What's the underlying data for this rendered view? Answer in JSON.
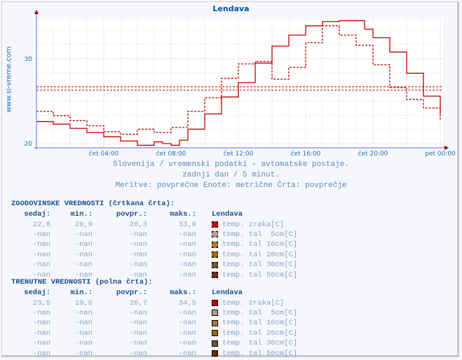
{
  "title": "Lendava",
  "side_label": "www.si-vreme.com",
  "subtitle_lines": [
    "Slovenija / vremenski podatki - avtomatske postaje.",
    "zadnji dan / 5 minut.",
    "Meritve: povprečne  Enote: metrične  Črta: povprečje"
  ],
  "colors": {
    "series": "#c00000",
    "axis": "#6060ff",
    "axis_arrow": "#8b0000",
    "grid": "#e8b0b0"
  },
  "chart_data": {
    "type": "line",
    "title": "Lendava",
    "xlabel": "",
    "ylabel": "",
    "x_unit": "hours since čet 00:00",
    "xlim": [
      0,
      24
    ],
    "ylim": [
      19.6,
      35.5
    ],
    "x_ticks": [
      {
        "x": 4,
        "label": "čet 04:00"
      },
      {
        "x": 8,
        "label": "čet 08:00"
      },
      {
        "x": 12,
        "label": "čet 12:00"
      },
      {
        "x": 16,
        "label": "čet 16:00"
      },
      {
        "x": 20,
        "label": "čet 20:00"
      },
      {
        "x": 24,
        "label": "pet 00:00"
      }
    ],
    "y_ticks": [
      {
        "y": 20,
        "label": "20"
      },
      {
        "y": 30,
        "label": "30"
      }
    ],
    "grid": true,
    "reference_lines": [
      {
        "name": "historical average",
        "y": 26.3,
        "style": "dashed"
      },
      {
        "name": "current average",
        "y": 26.7,
        "style": "dashed"
      }
    ],
    "series": [
      {
        "name": "temp. zraka [C] (trenutne, polna črta)",
        "style": "solid",
        "x": [
          0,
          1,
          2,
          3,
          4,
          5,
          6,
          7,
          7.5,
          8,
          8.5,
          9,
          10,
          11,
          12,
          13,
          14,
          15,
          16,
          17,
          18,
          19,
          19.5,
          20,
          21,
          22,
          23,
          24
        ],
        "values": [
          22.6,
          22.3,
          21.8,
          21.3,
          20.8,
          20.3,
          19.8,
          20.2,
          20.0,
          19.8,
          20.4,
          21.7,
          23.5,
          25.5,
          27.2,
          29.5,
          31.5,
          32.8,
          33.9,
          34.4,
          34.5,
          34.5,
          33.5,
          32.5,
          30.8,
          28.3,
          25.6,
          23.5
        ]
      },
      {
        "name": "temp. zraka [C] (zgodovinske, črtkana črta)",
        "style": "dashed",
        "x": [
          0,
          1,
          2,
          3,
          4,
          5,
          6,
          7,
          8,
          9,
          10,
          11,
          12,
          13,
          14,
          15,
          16,
          17,
          18,
          19,
          20,
          21,
          22,
          23,
          24
        ],
        "values": [
          23.8,
          23.3,
          22.7,
          22.1,
          21.4,
          21.1,
          21.7,
          21.3,
          21.9,
          23.8,
          25.4,
          27.7,
          29.4,
          29.7,
          27.6,
          29.0,
          31.9,
          33.9,
          32.8,
          31.6,
          29.3,
          26.6,
          25.2,
          24.2,
          22.8
        ]
      }
    ]
  },
  "historical": {
    "title": "ZGODOVINSKE VREDNOSTI (črtkana črta):",
    "headers": [
      "sedaj:",
      "min.:",
      "povpr.:",
      "maks.:",
      "Lendava"
    ],
    "rows": [
      {
        "sedaj": "22,8",
        "min": "20,9",
        "povpr": "26,3",
        "maks": "33,9",
        "label": "temp. zraka[C]",
        "color": "#cc0000"
      },
      {
        "sedaj": "-nan",
        "min": "-nan",
        "povpr": "-nan",
        "maks": "-nan",
        "label": "temp. tal  5cm[C]",
        "color": "#c09898"
      },
      {
        "sedaj": "-nan",
        "min": "-nan",
        "povpr": "-nan",
        "maks": "-nan",
        "label": "temp. tal 10cm[C]",
        "color": "#b07838"
      },
      {
        "sedaj": "-nan",
        "min": "-nan",
        "povpr": "-nan",
        "maks": "-nan",
        "label": "temp. tal 20cm[C]",
        "color": "#a86800"
      },
      {
        "sedaj": "-nan",
        "min": "-nan",
        "povpr": "-nan",
        "maks": "-nan",
        "label": "temp. tal 30cm[C]",
        "color": "#685838"
      },
      {
        "sedaj": "-nan",
        "min": "-nan",
        "povpr": "-nan",
        "maks": "-nan",
        "label": "temp. tal 50cm[C]",
        "color": "#683000"
      }
    ]
  },
  "current": {
    "title": "TRENUTNE VREDNOSTI (polna črta):",
    "headers": [
      "sedaj:",
      "min.:",
      "povpr.:",
      "maks.:",
      "Lendava"
    ],
    "rows": [
      {
        "sedaj": "23,5",
        "min": "19,6",
        "povpr": "26,7",
        "maks": "34,5",
        "label": "temp. zraka[C]",
        "color": "#cc0000"
      },
      {
        "sedaj": "-nan",
        "min": "-nan",
        "povpr": "-nan",
        "maks": "-nan",
        "label": "temp. tal  5cm[C]",
        "color": "#c09898"
      },
      {
        "sedaj": "-nan",
        "min": "-nan",
        "povpr": "-nan",
        "maks": "-nan",
        "label": "temp. tal 10cm[C]",
        "color": "#b07838"
      },
      {
        "sedaj": "-nan",
        "min": "-nan",
        "povpr": "-nan",
        "maks": "-nan",
        "label": "temp. tal 20cm[C]",
        "color": "#a86800"
      },
      {
        "sedaj": "-nan",
        "min": "-nan",
        "povpr": "-nan",
        "maks": "-nan",
        "label": "temp. tal 30cm[C]",
        "color": "#685838"
      },
      {
        "sedaj": "-nan",
        "min": "-nan",
        "povpr": "-nan",
        "maks": "-nan",
        "label": "temp. tal 50cm[C]",
        "color": "#683000"
      }
    ]
  }
}
